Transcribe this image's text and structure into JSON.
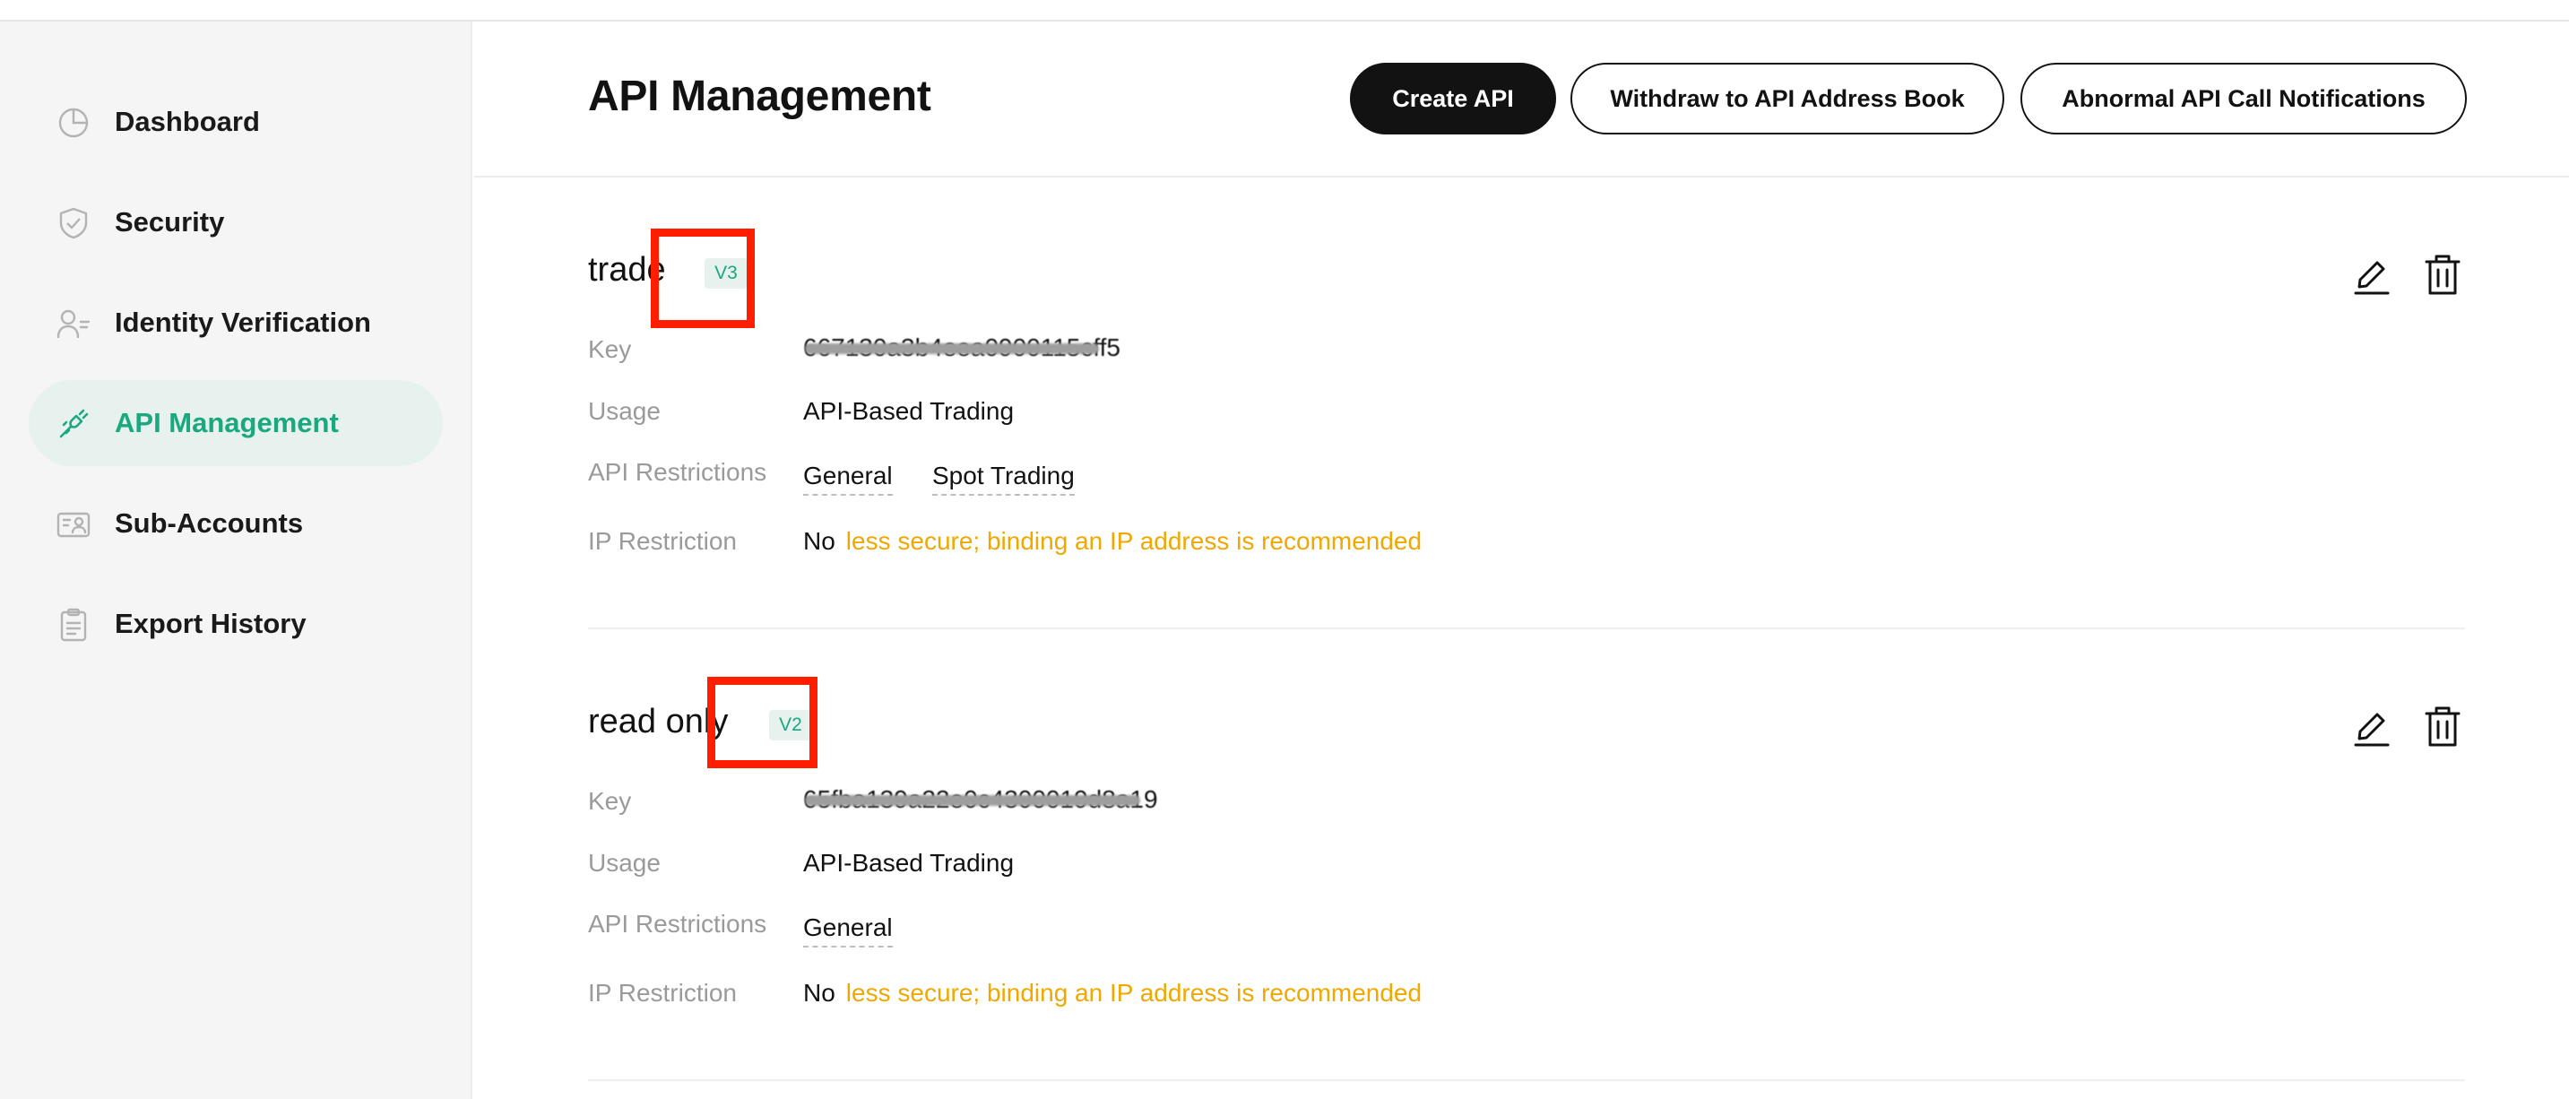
{
  "sidebar": {
    "items": [
      {
        "label": "Dashboard",
        "icon": "pie-chart-icon",
        "active": false
      },
      {
        "label": "Security",
        "icon": "shield-icon",
        "active": false
      },
      {
        "label": "Identity Verification",
        "icon": "user-id-icon",
        "active": false
      },
      {
        "label": "API Management",
        "icon": "plug-icon",
        "active": true
      },
      {
        "label": "Sub-Accounts",
        "icon": "id-card-icon",
        "active": false
      },
      {
        "label": "Export History",
        "icon": "clipboard-icon",
        "active": false
      }
    ]
  },
  "header": {
    "title": "API Management",
    "create_label": "Create API",
    "address_book_label": "Withdraw to API Address Book",
    "notifications_label": "Abnormal API Call Notifications"
  },
  "colors": {
    "accent": "#1aa87f",
    "warning": "#f0a800",
    "highlight": "#ff1e00",
    "primary_button": "#121212"
  },
  "labels": {
    "key": "Key",
    "usage": "Usage",
    "restrictions": "API Restrictions",
    "ip": "IP Restriction"
  },
  "apis": [
    {
      "name": "trade",
      "version": "V3",
      "key_masked": "667130a3b4eea0900115cff5",
      "usage": "API-Based Trading",
      "restrictions": [
        "General",
        "Spot Trading"
      ],
      "ip_value": "No",
      "ip_warning": "less secure; binding an IP address is recommended"
    },
    {
      "name": "read only",
      "version": "V2",
      "key_masked": "65fba139a22e0c4300019d8a19",
      "usage": "API-Based Trading",
      "restrictions": [
        "General"
      ],
      "ip_value": "No",
      "ip_warning": "less secure; binding an IP address is recommended"
    }
  ]
}
